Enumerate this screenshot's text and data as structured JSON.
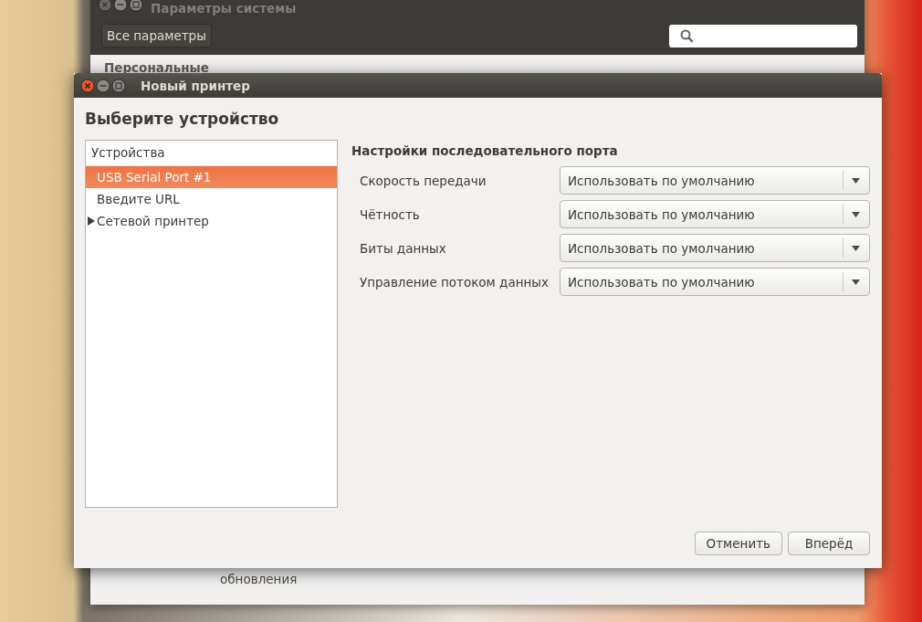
{
  "background_window": {
    "title": "Параметры системы",
    "all_settings_button": "Все параметры",
    "section_heading": "Персональные",
    "item_label": "обновления"
  },
  "dialog": {
    "title": "Новый принтер",
    "heading": "Выберите устройство",
    "device_list": {
      "header": "Устройства",
      "items": [
        {
          "label": "USB Serial Port #1",
          "kind": "leaf",
          "selected": true
        },
        {
          "label": "Введите URL",
          "kind": "leaf",
          "selected": false
        },
        {
          "label": "Сетевой принтер",
          "kind": "group",
          "selected": false,
          "expanded": false
        }
      ]
    },
    "settings": {
      "heading": "Настройки последовательного порта",
      "fields": [
        {
          "label": "Скорость передачи",
          "value": "Использовать по умолчанию"
        },
        {
          "label": "Чётность",
          "value": "Использовать по умолчанию"
        },
        {
          "label": "Биты данных",
          "value": "Использовать по умолчанию"
        },
        {
          "label": "Управление потоком данных",
          "value": "Использовать по умолчанию"
        }
      ]
    },
    "buttons": [
      {
        "label": "Отменить"
      },
      {
        "label": "Вперёд"
      }
    ]
  }
}
